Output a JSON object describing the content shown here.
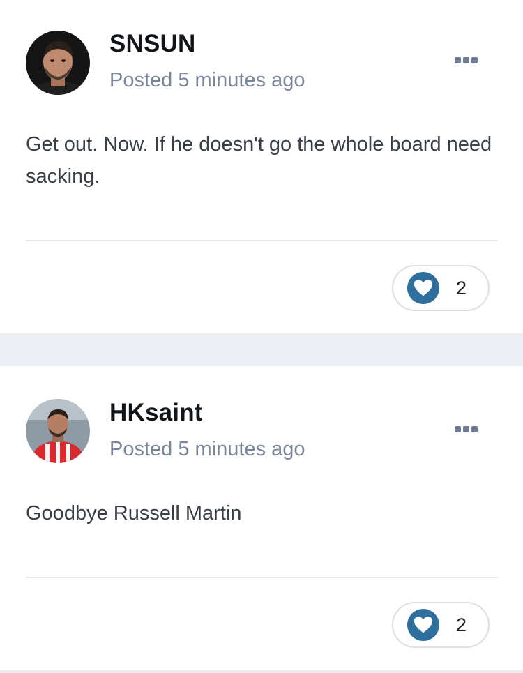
{
  "posts": [
    {
      "author": "SNSUN",
      "meta": "Posted 5 minutes ago",
      "content": "Get out. Now. If he doesn't go the whole board need sacking.",
      "reaction_count": "2",
      "avatar_icon": "user-avatar",
      "reaction_icon": "heart-icon",
      "more_icon": "ellipsis-icon"
    },
    {
      "author": "HKsaint",
      "meta": "Posted 5 minutes ago",
      "content": "Goodbye Russell Martin",
      "reaction_count": "2",
      "avatar_icon": "user-avatar",
      "reaction_icon": "heart-icon",
      "more_icon": "ellipsis-icon"
    }
  ],
  "colors": {
    "background": "#ebeef3",
    "card": "#ffffff",
    "author": "#111418",
    "meta": "#7a869e",
    "content": "#3a3f47",
    "reaction_accent": "#2f6f9e",
    "divider": "#e6e9ee"
  }
}
